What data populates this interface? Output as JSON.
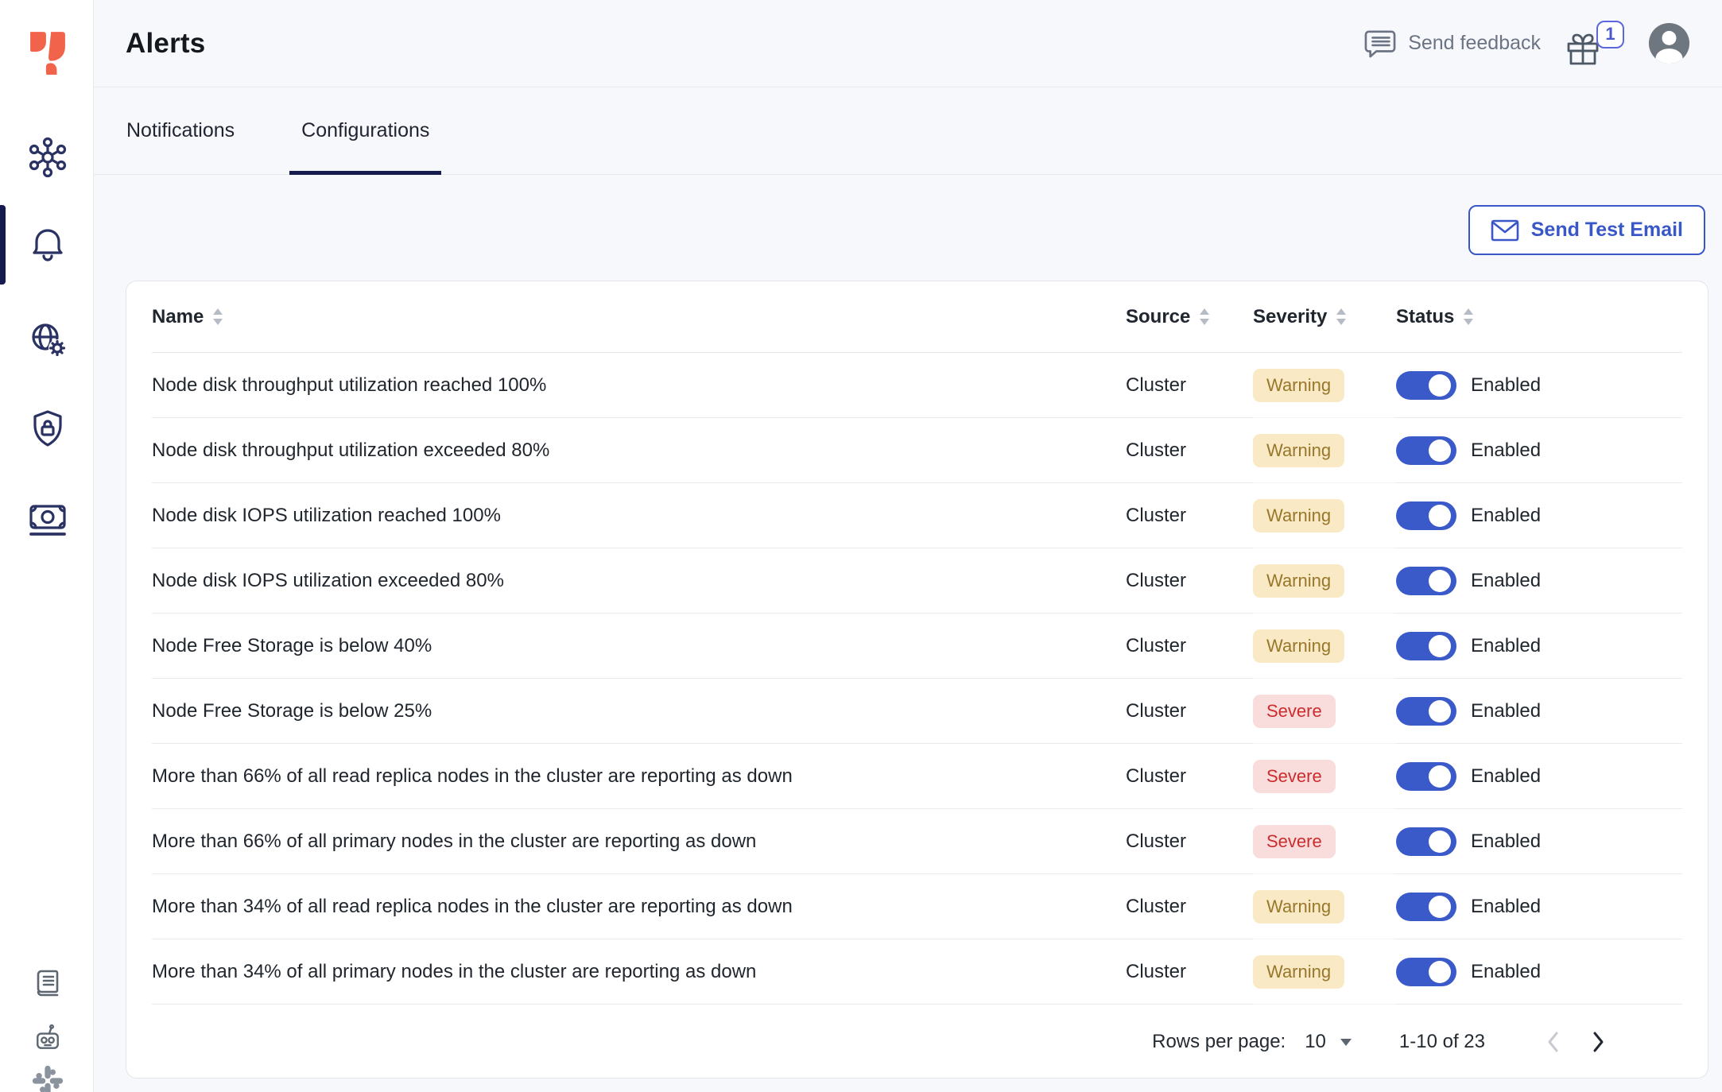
{
  "header": {
    "title": "Alerts",
    "feedback_label": "Send feedback",
    "gift_badge_count": "1"
  },
  "tabs": {
    "items": [
      {
        "label": "Notifications",
        "active": false
      },
      {
        "label": "Configurations",
        "active": true
      }
    ]
  },
  "toolbar": {
    "send_test_email_label": "Send Test Email"
  },
  "table": {
    "columns": [
      {
        "label": "Name"
      },
      {
        "label": "Source"
      },
      {
        "label": "Severity"
      },
      {
        "label": "Status"
      }
    ],
    "rows": [
      {
        "name": "Node disk throughput utilization reached 100%",
        "source": "Cluster",
        "severity": "Warning",
        "status": "Enabled"
      },
      {
        "name": "Node disk throughput utilization exceeded 80%",
        "source": "Cluster",
        "severity": "Warning",
        "status": "Enabled"
      },
      {
        "name": "Node disk IOPS utilization reached 100%",
        "source": "Cluster",
        "severity": "Warning",
        "status": "Enabled"
      },
      {
        "name": "Node disk IOPS utilization exceeded 80%",
        "source": "Cluster",
        "severity": "Warning",
        "status": "Enabled"
      },
      {
        "name": "Node Free Storage is below 40%",
        "source": "Cluster",
        "severity": "Warning",
        "status": "Enabled"
      },
      {
        "name": "Node Free Storage is below 25%",
        "source": "Cluster",
        "severity": "Severe",
        "status": "Enabled"
      },
      {
        "name": "More than 66% of all read replica nodes in the cluster are reporting as down",
        "source": "Cluster",
        "severity": "Severe",
        "status": "Enabled"
      },
      {
        "name": "More than 66% of all primary nodes in the cluster are reporting as down",
        "source": "Cluster",
        "severity": "Severe",
        "status": "Enabled"
      },
      {
        "name": "More than 34% of all read replica nodes in the cluster are reporting as down",
        "source": "Cluster",
        "severity": "Warning",
        "status": "Enabled"
      },
      {
        "name": "More than 34% of all primary nodes in the cluster are reporting as down",
        "source": "Cluster",
        "severity": "Warning",
        "status": "Enabled"
      }
    ]
  },
  "pagination": {
    "rows_per_page_label": "Rows per page:",
    "rows_per_page_value": "10",
    "range_label": "1-10 of 23"
  },
  "sidebar": {
    "icons": [
      "yugabyte-logo",
      "clusters-icon",
      "alerts-bell-icon",
      "network-settings-icon",
      "security-shield-icon",
      "billing-icon",
      "docs-book-icon",
      "chatbot-robot-icon",
      "slack-icon"
    ]
  },
  "colors": {
    "accent_blue": "#3a57c8",
    "toggle_on": "#3a5aca",
    "active_navy": "#161d4e",
    "logo_orange": "#f2634b",
    "warning_bg": "#fae9c5",
    "warning_text": "#97772a",
    "severe_bg": "#f9dddd",
    "severe_text": "#cc2c2c",
    "badge_border": "#5b67da"
  }
}
